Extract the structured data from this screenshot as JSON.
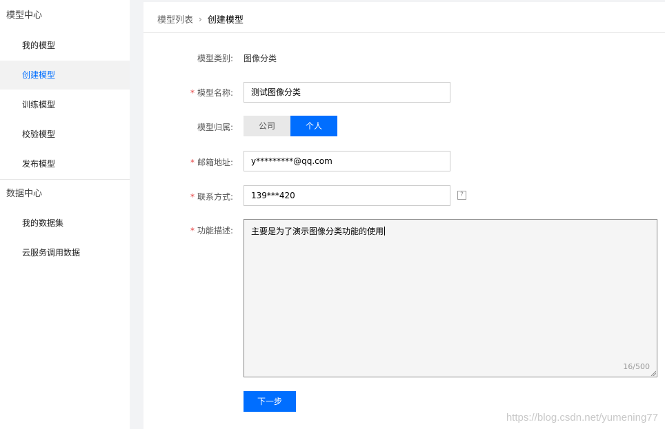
{
  "sidebar": {
    "model_center": {
      "title": "模型中心",
      "items": [
        {
          "label": "我的模型",
          "active": false
        },
        {
          "label": "创建模型",
          "active": true
        },
        {
          "label": "训练模型",
          "active": false
        },
        {
          "label": "校验模型",
          "active": false
        },
        {
          "label": "发布模型",
          "active": false
        }
      ]
    },
    "data_center": {
      "title": "数据中心",
      "items": [
        {
          "label": "我的数据集",
          "active": false
        },
        {
          "label": "云服务调用数据",
          "active": false
        }
      ]
    }
  },
  "breadcrumb": {
    "parent": "模型列表",
    "separator": "›",
    "current": "创建模型"
  },
  "form": {
    "model_type": {
      "label": "模型类别:",
      "value": "图像分类"
    },
    "model_name": {
      "label": "模型名称:",
      "required_mark": "*",
      "value": "测试图像分类"
    },
    "ownership": {
      "label": "模型归属:",
      "options": [
        "公司",
        "个人"
      ],
      "selected": "个人"
    },
    "email": {
      "label": "邮箱地址:",
      "required_mark": "*",
      "value": "y*********@qq.com"
    },
    "contact": {
      "label": "联系方式:",
      "required_mark": "*",
      "value": "139***420",
      "help_icon": "?"
    },
    "description": {
      "label": "功能描述:",
      "required_mark": "*",
      "value": "主要是为了演示图像分类功能的使用",
      "counter": "16/500"
    },
    "next_button": "下一步"
  },
  "watermark": "https://blog.csdn.net/yumening77",
  "colors": {
    "accent": "#006eff",
    "required": "#e54545"
  }
}
